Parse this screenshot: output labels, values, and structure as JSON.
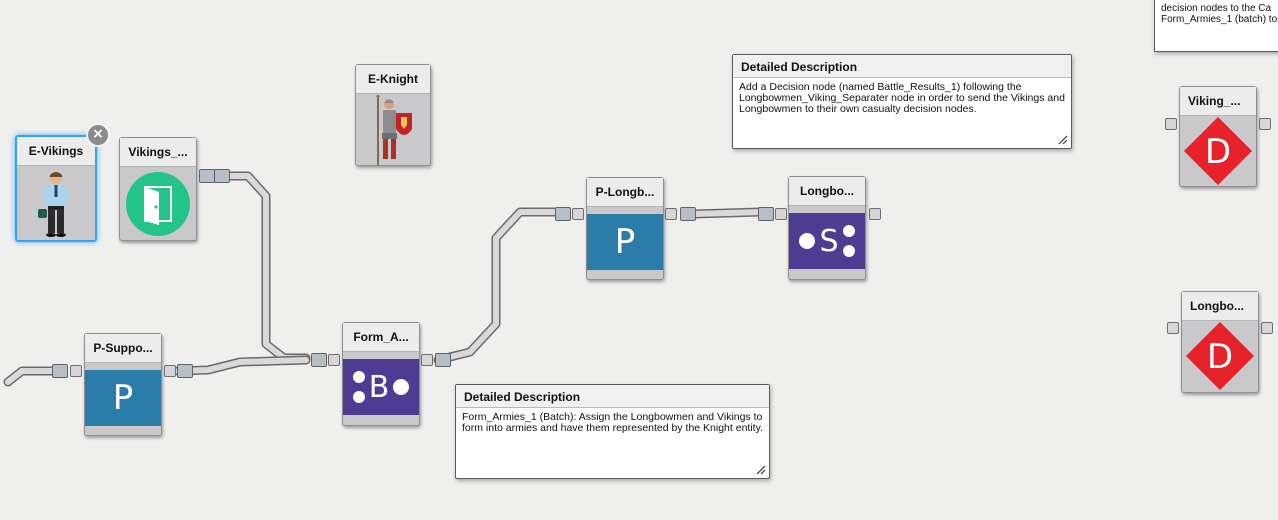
{
  "nodes": {
    "e_vikings": {
      "title": "E-Vikings"
    },
    "vikings_exit": {
      "title": "Vikings_..."
    },
    "e_knight": {
      "title": "E-Knight"
    },
    "p_support": {
      "title": "P-Suppo...",
      "glyph": "P"
    },
    "form_armies": {
      "title": "Form_A...",
      "glyph": "B"
    },
    "p_longbowmen": {
      "title": "P-Longb...",
      "glyph": "P"
    },
    "longbowmen_separator": {
      "title": "Longbo...",
      "glyph": "S"
    },
    "viking_decision": {
      "title": "Viking_...",
      "glyph": "D"
    },
    "longbowmen_decision": {
      "title": "Longbo...",
      "glyph": "D"
    }
  },
  "descriptions": {
    "top": {
      "header": "Detailed Description",
      "text": "Add a Decision node (named Battle_Results_1) following the Longbowmen_Viking_Separater node in order to send the Vikings and Longbowmen to their own casualty decision nodes."
    },
    "bottom": {
      "header": "Detailed Description",
      "text": "Form_Armies_1 (Batch): Assign the Longbowmen and Vikings to form into armies and have them represented by the Knight entity."
    },
    "partial_line1": "decision nodes to the Ca",
    "partial_line2": "Form_Armies_1 (batch) to"
  },
  "icons": {
    "close": "×",
    "colors": {
      "process": "#2b7bab",
      "batch_separate": "#4d3c92",
      "exit": "#22c48a",
      "decision": "#e8222a",
      "selection": "#3aa0e8"
    }
  }
}
